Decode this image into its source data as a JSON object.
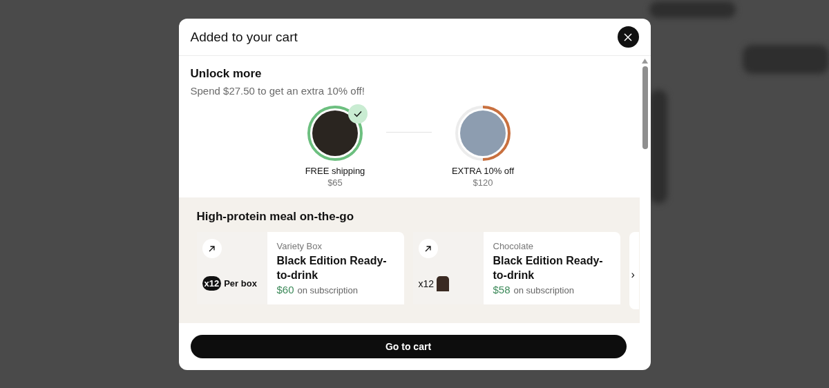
{
  "modal": {
    "title": "Added to your cart"
  },
  "unlock": {
    "title": "Unlock more",
    "message": "Spend $27.50 to get an extra 10% off!",
    "milestones": [
      {
        "label": "FREE shipping",
        "amount": "$65",
        "level": 1,
        "achieved": true,
        "color": "#6cbf7f"
      },
      {
        "label": "EXTRA 10% off",
        "amount": "$120",
        "level": 0.5,
        "achieved": false,
        "color": "#c8703f"
      }
    ]
  },
  "recommendations": {
    "title": "High-protein meal on-the-go",
    "next": "›",
    "products": [
      {
        "variant": "Variety Box",
        "name": "Black Edition Ready-to-drink",
        "price": "$60",
        "price_note": "on subscription",
        "badge": "x12",
        "badge_note": "Per box",
        "kind": "box"
      },
      {
        "variant": "Chocolate",
        "name": "Black Edition Ready-to-drink",
        "price": "$58",
        "price_note": "on subscription",
        "badge": "x12",
        "kind": "bottle"
      }
    ]
  },
  "footer": {
    "button": "Go to cart"
  }
}
